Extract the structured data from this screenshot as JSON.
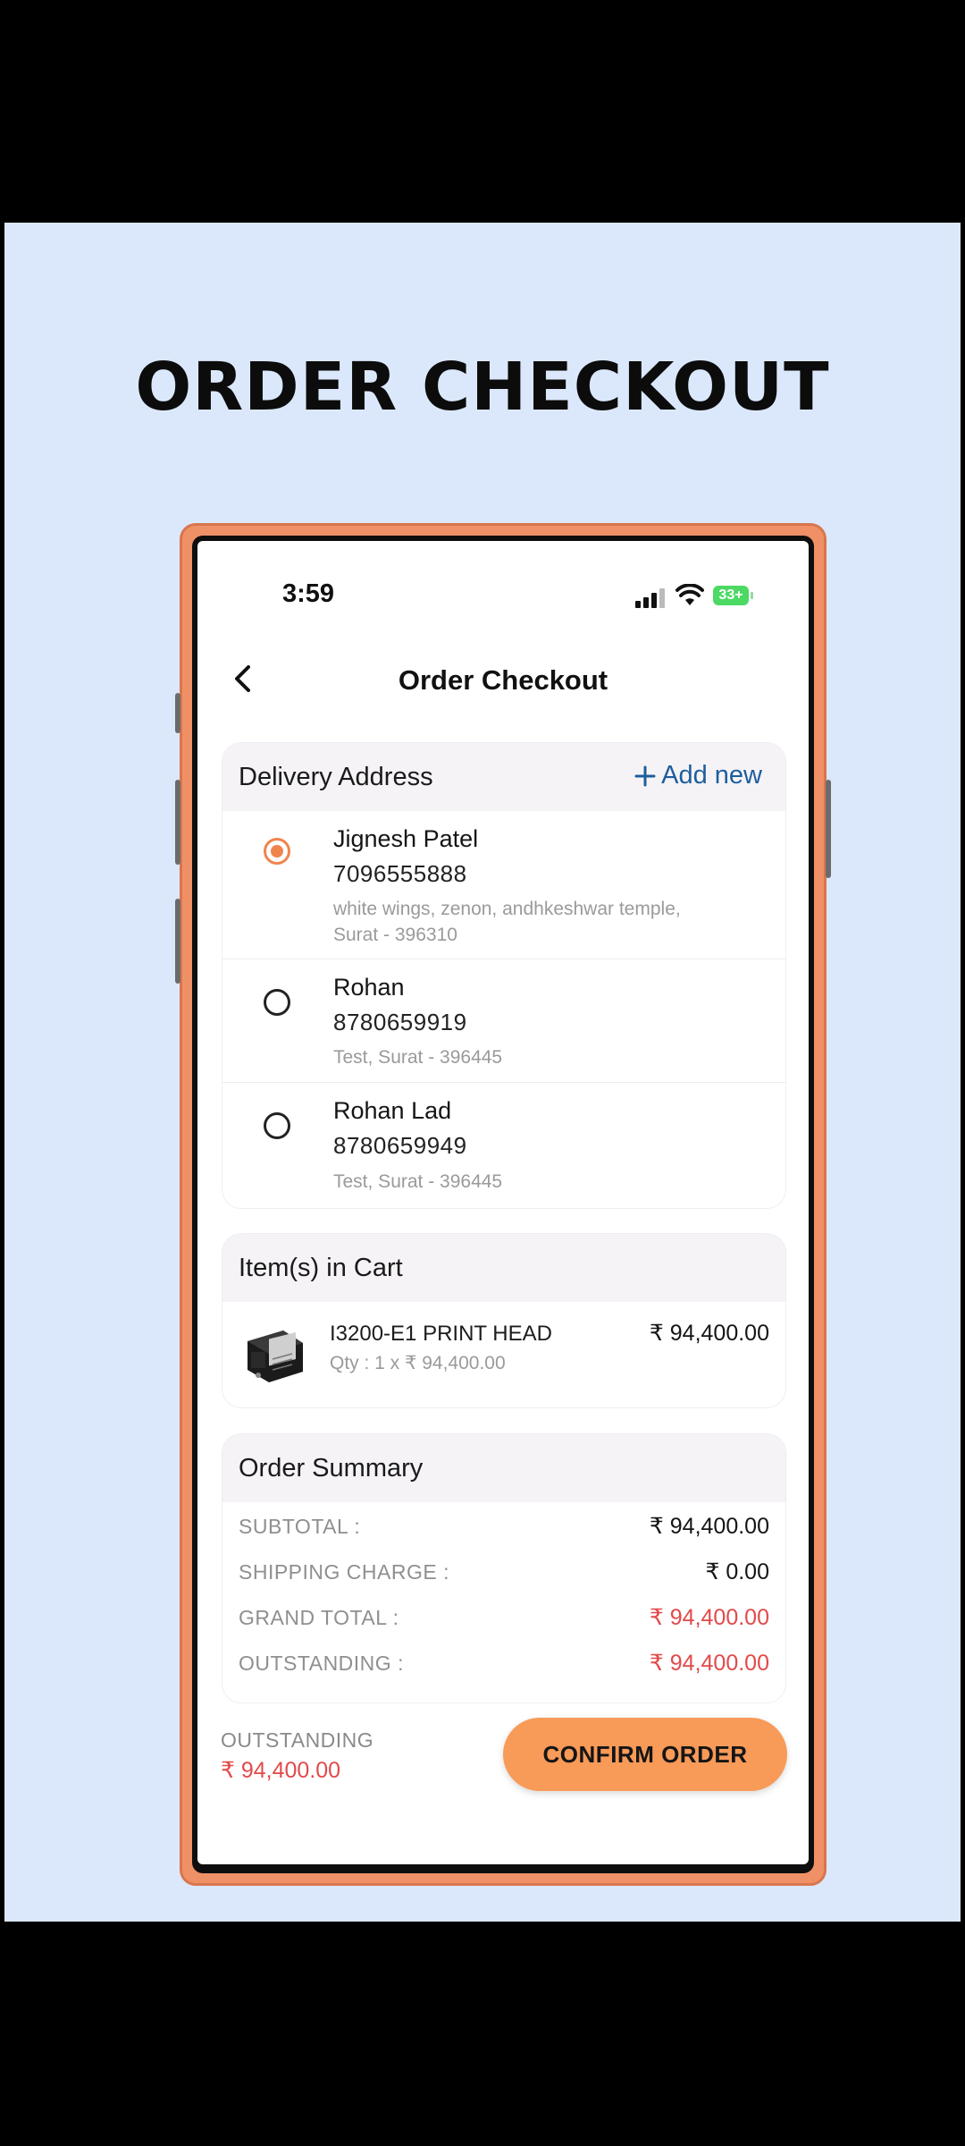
{
  "promo": {
    "title": "ORDER CHECKOUT"
  },
  "status_bar": {
    "time": "3:59",
    "battery": "33+"
  },
  "nav": {
    "title": "Order Checkout",
    "back_icon": "chevron-left-icon"
  },
  "delivery": {
    "heading": "Delivery Address",
    "add_new_label": "Add new",
    "addresses": [
      {
        "name": "Jignesh Patel",
        "phone": "7096555888",
        "line1": "white wings, zenon, andhkeshwar temple,",
        "line2": "Surat - 396310",
        "selected": true
      },
      {
        "name": "Rohan",
        "phone": "8780659919",
        "line1": "Test, Surat - 396445",
        "selected": false
      },
      {
        "name": "Rohan Lad",
        "phone": "8780659949",
        "line1": "Test, Surat - 396445",
        "selected": false
      }
    ]
  },
  "cart": {
    "heading": "Item(s) in Cart",
    "items": [
      {
        "name": "I3200-E1 PRINT HEAD",
        "qty_text": "Qty : 1 x ₹ 94,400.00",
        "price": "₹ 94,400.00"
      }
    ]
  },
  "summary": {
    "heading": "Order Summary",
    "rows": [
      {
        "label": "SUBTOTAL :",
        "value": "₹ 94,400.00"
      },
      {
        "label": "SHIPPING CHARGE :",
        "value": "₹ 0.00"
      },
      {
        "label": "GRAND TOTAL :",
        "value": "₹ 94,400.00"
      },
      {
        "label": "OUTSTANDING :",
        "value": "₹ 94,400.00"
      }
    ]
  },
  "footer": {
    "outstanding_label": "OUTSTANDING",
    "outstanding_value": "₹ 94,400.00",
    "confirm_label": "CONFIRM ORDER"
  },
  "colors": {
    "accent": "#f89a58",
    "radio_selected": "#f0844d",
    "link": "#1d5e9c",
    "amount_red": "#e24a4a",
    "background": "#dbe8fb"
  }
}
